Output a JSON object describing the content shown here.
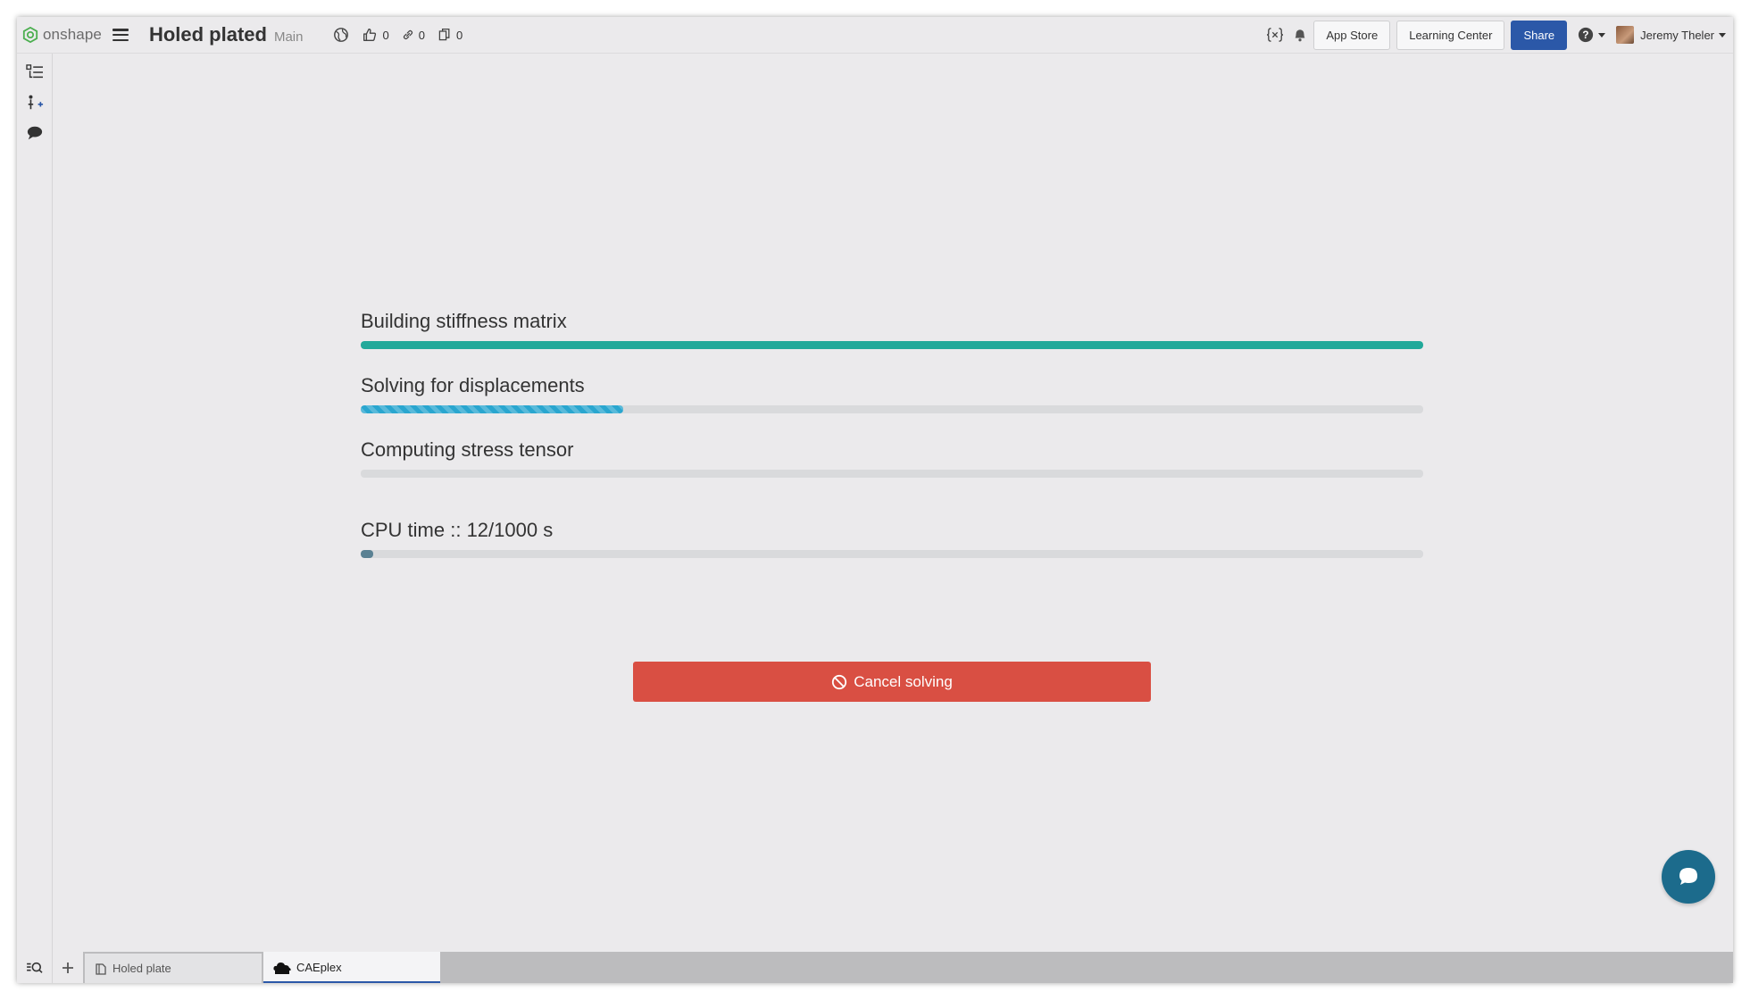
{
  "topbar": {
    "logo_text": "onshape",
    "doc_title": "Holed plated",
    "branch": "Main",
    "likes": "0",
    "links": "0",
    "copies": "0",
    "app_store_label": "App Store",
    "learning_center_label": "Learning Center",
    "share_label": "Share",
    "user_name": "Jeremy Theler"
  },
  "progress": [
    {
      "label": "Building stiffness matrix",
      "fraction": 1.0,
      "color": "#21a99a",
      "striped": false
    },
    {
      "label": "Solving for displacements",
      "fraction": 0.247,
      "color": "#2aa6cf",
      "striped": true
    },
    {
      "label": "Computing stress tensor",
      "fraction": 0.0,
      "color": "#21a99a",
      "striped": false
    },
    {
      "label": "CPU time :: 12/1000 s",
      "fraction": 0.012,
      "color": "#5a8193",
      "striped": false
    }
  ],
  "cancel_label": "Cancel solving",
  "tabs": [
    {
      "label": "Holed plate",
      "active": false
    },
    {
      "label": "CAEplex",
      "active": true
    }
  ],
  "colors": {
    "accent": "#2b58a8",
    "danger": "#d94f43",
    "chat": "#1c6b8c"
  }
}
